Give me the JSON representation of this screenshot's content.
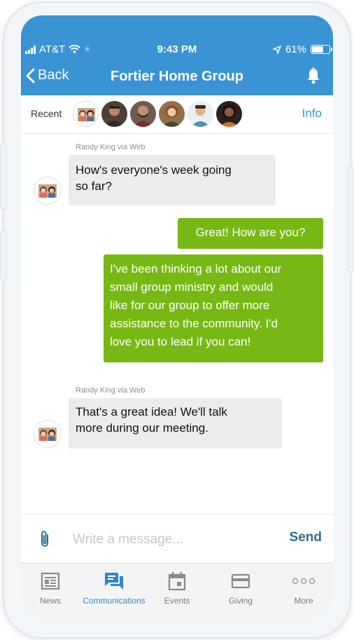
{
  "status_bar": {
    "carrier": "AT&T",
    "time": "9:43 PM",
    "battery": "61%"
  },
  "header": {
    "back_label": "Back",
    "title": "Fortier Home Group"
  },
  "recent": {
    "label": "Recent",
    "info_label": "Info",
    "avatars": [
      "group-avatar",
      "person-avatar-1",
      "person-avatar-2",
      "person-avatar-3",
      "person-avatar-4",
      "person-avatar-5"
    ]
  },
  "messages": [
    {
      "direction": "incoming",
      "sender": "Randy King via Web",
      "text_lines": [
        "How's everyone's week going",
        "so far?"
      ]
    },
    {
      "direction": "outgoing",
      "text_lines": [
        "Great!  How are you?"
      ]
    },
    {
      "direction": "outgoing",
      "text_lines": [
        "I've been thinking a lot about our",
        "small group ministry and would",
        "like for our group to offer more",
        "assistance to the community.  I'd",
        "love you to lead if you can!"
      ]
    },
    {
      "direction": "incoming",
      "sender": "Randy King via Web",
      "text_lines": [
        "That's a great idea!  We'll talk",
        "more during our meeting."
      ]
    }
  ],
  "composer": {
    "placeholder": "Write a message...",
    "value": "",
    "send_label": "Send"
  },
  "tabs": [
    {
      "label": "News",
      "icon": "news-icon",
      "active": false
    },
    {
      "label": "Communications",
      "icon": "communications-icon",
      "active": true
    },
    {
      "label": "Events",
      "icon": "calendar-icon",
      "active": false
    },
    {
      "label": "Giving",
      "icon": "card-icon",
      "active": false
    },
    {
      "label": "More",
      "icon": "more-icon",
      "active": false
    }
  ],
  "colors": {
    "header_blue": "#3a93d3",
    "outgoing_green": "#78b815",
    "incoming_gray": "#ececec",
    "active_tab": "#2f89c8"
  }
}
